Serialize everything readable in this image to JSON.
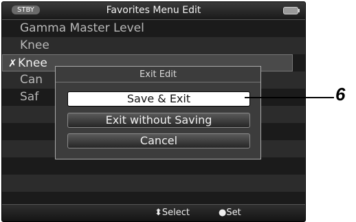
{
  "header": {
    "status": "STBY",
    "title": "Favorites Menu Edit"
  },
  "menu": {
    "items": [
      {
        "label": "Gamma Master Level",
        "mark": ""
      },
      {
        "label": "Knee",
        "mark": ""
      },
      {
        "label": "Knee",
        "mark": "✗",
        "selected": true
      },
      {
        "label": "Can",
        "mark": ""
      },
      {
        "label": "Saf",
        "mark": ""
      }
    ]
  },
  "dialog": {
    "title": "Exit Edit",
    "buttons": {
      "save_exit": "Save & Exit",
      "exit_without_saving": "Exit without Saving",
      "cancel": "Cancel"
    }
  },
  "footer": {
    "select_hint": "⬍Select",
    "set_hint": "●Set"
  },
  "callout": {
    "number": "6"
  }
}
